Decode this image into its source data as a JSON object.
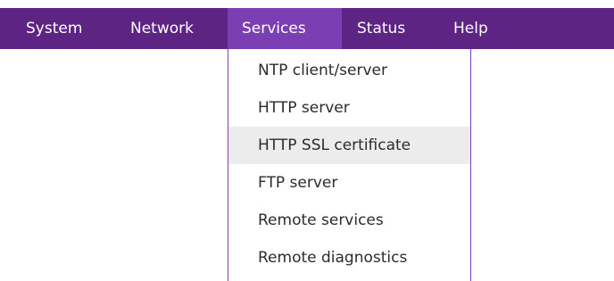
{
  "menubar": {
    "items": [
      {
        "label": "System"
      },
      {
        "label": "Network"
      },
      {
        "label": "Services",
        "active": true
      },
      {
        "label": "Status"
      },
      {
        "label": "Help"
      }
    ]
  },
  "dropdown": {
    "items": [
      {
        "label": "NTP client/server"
      },
      {
        "label": "HTTP server"
      },
      {
        "label": "HTTP SSL certificate",
        "highlighted": true
      },
      {
        "label": "FTP server"
      },
      {
        "label": "Remote services"
      },
      {
        "label": "Remote diagnostics"
      }
    ]
  },
  "colors": {
    "menubar_bg": "#5d2484",
    "active_bg": "#7c3fb3",
    "hover_bg": "#ececec",
    "menu_text": "#ffffff",
    "dropdown_text": "#2b2b2b"
  }
}
